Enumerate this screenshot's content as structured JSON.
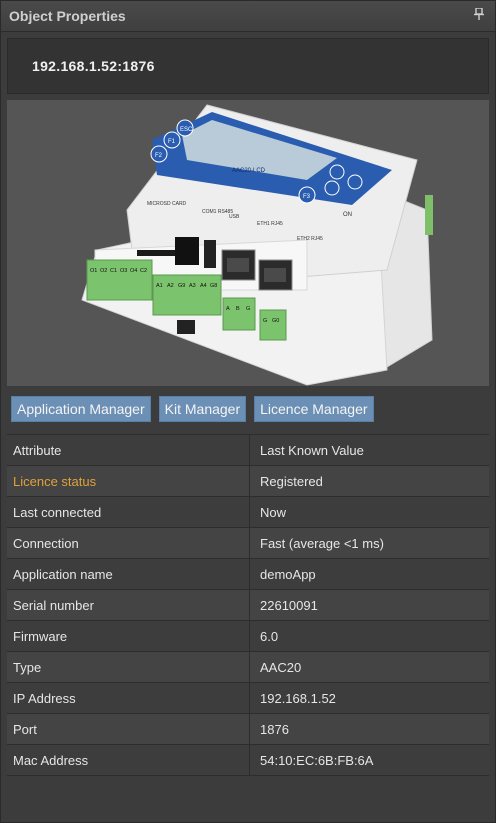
{
  "panel": {
    "title": "Object Properties",
    "pin_icon": "pin-icon"
  },
  "device": {
    "address": "192.168.1.52:1876",
    "image_labels": {
      "esc": "ESC",
      "f1": "F1",
      "f2": "F2",
      "f3": "F3",
      "brand": "AAC20-LCD",
      "micro_sd": "MICROSD CARD",
      "com1": "COM1 RS485",
      "usb": "USB",
      "eth1": "ETH1 RJ45",
      "eth2": "ETH2 RJ45",
      "on": "ON",
      "relays": [
        "O1",
        "O2",
        "C1",
        "O3",
        "O4",
        "C2"
      ],
      "analog": [
        "A1",
        "A2",
        "G9",
        "A3",
        "A4",
        "G8"
      ],
      "bus": [
        "A",
        "B",
        "G"
      ],
      "power": [
        "G",
        "G0"
      ]
    }
  },
  "buttons": {
    "application_manager": "Application Manager",
    "kit_manager": "Kit Manager",
    "licence_manager": "Licence Manager"
  },
  "table": {
    "header": {
      "attribute": "Attribute",
      "value": "Last Known Value"
    },
    "rows": [
      {
        "attribute": "Licence status",
        "value": "Registered"
      },
      {
        "attribute": "Last connected",
        "value": "Now"
      },
      {
        "attribute": "Connection",
        "value": "Fast (average <1 ms)"
      },
      {
        "attribute": "Application name",
        "value": "demoApp"
      },
      {
        "attribute": "Serial number",
        "value": "22610091"
      },
      {
        "attribute": "Firmware",
        "value": "6.0"
      },
      {
        "attribute": "Type",
        "value": "AAC20"
      },
      {
        "attribute": "IP Address",
        "value": "192.168.1.52"
      },
      {
        "attribute": "Port",
        "value": "1876"
      },
      {
        "attribute": "Mac Address",
        "value": "54:10:EC:6B:FB:6A"
      }
    ]
  },
  "colors": {
    "accent_button": "#6b8fb5",
    "highlight_text": "#e0a13a",
    "panel_bg": "#3c3c3c"
  }
}
